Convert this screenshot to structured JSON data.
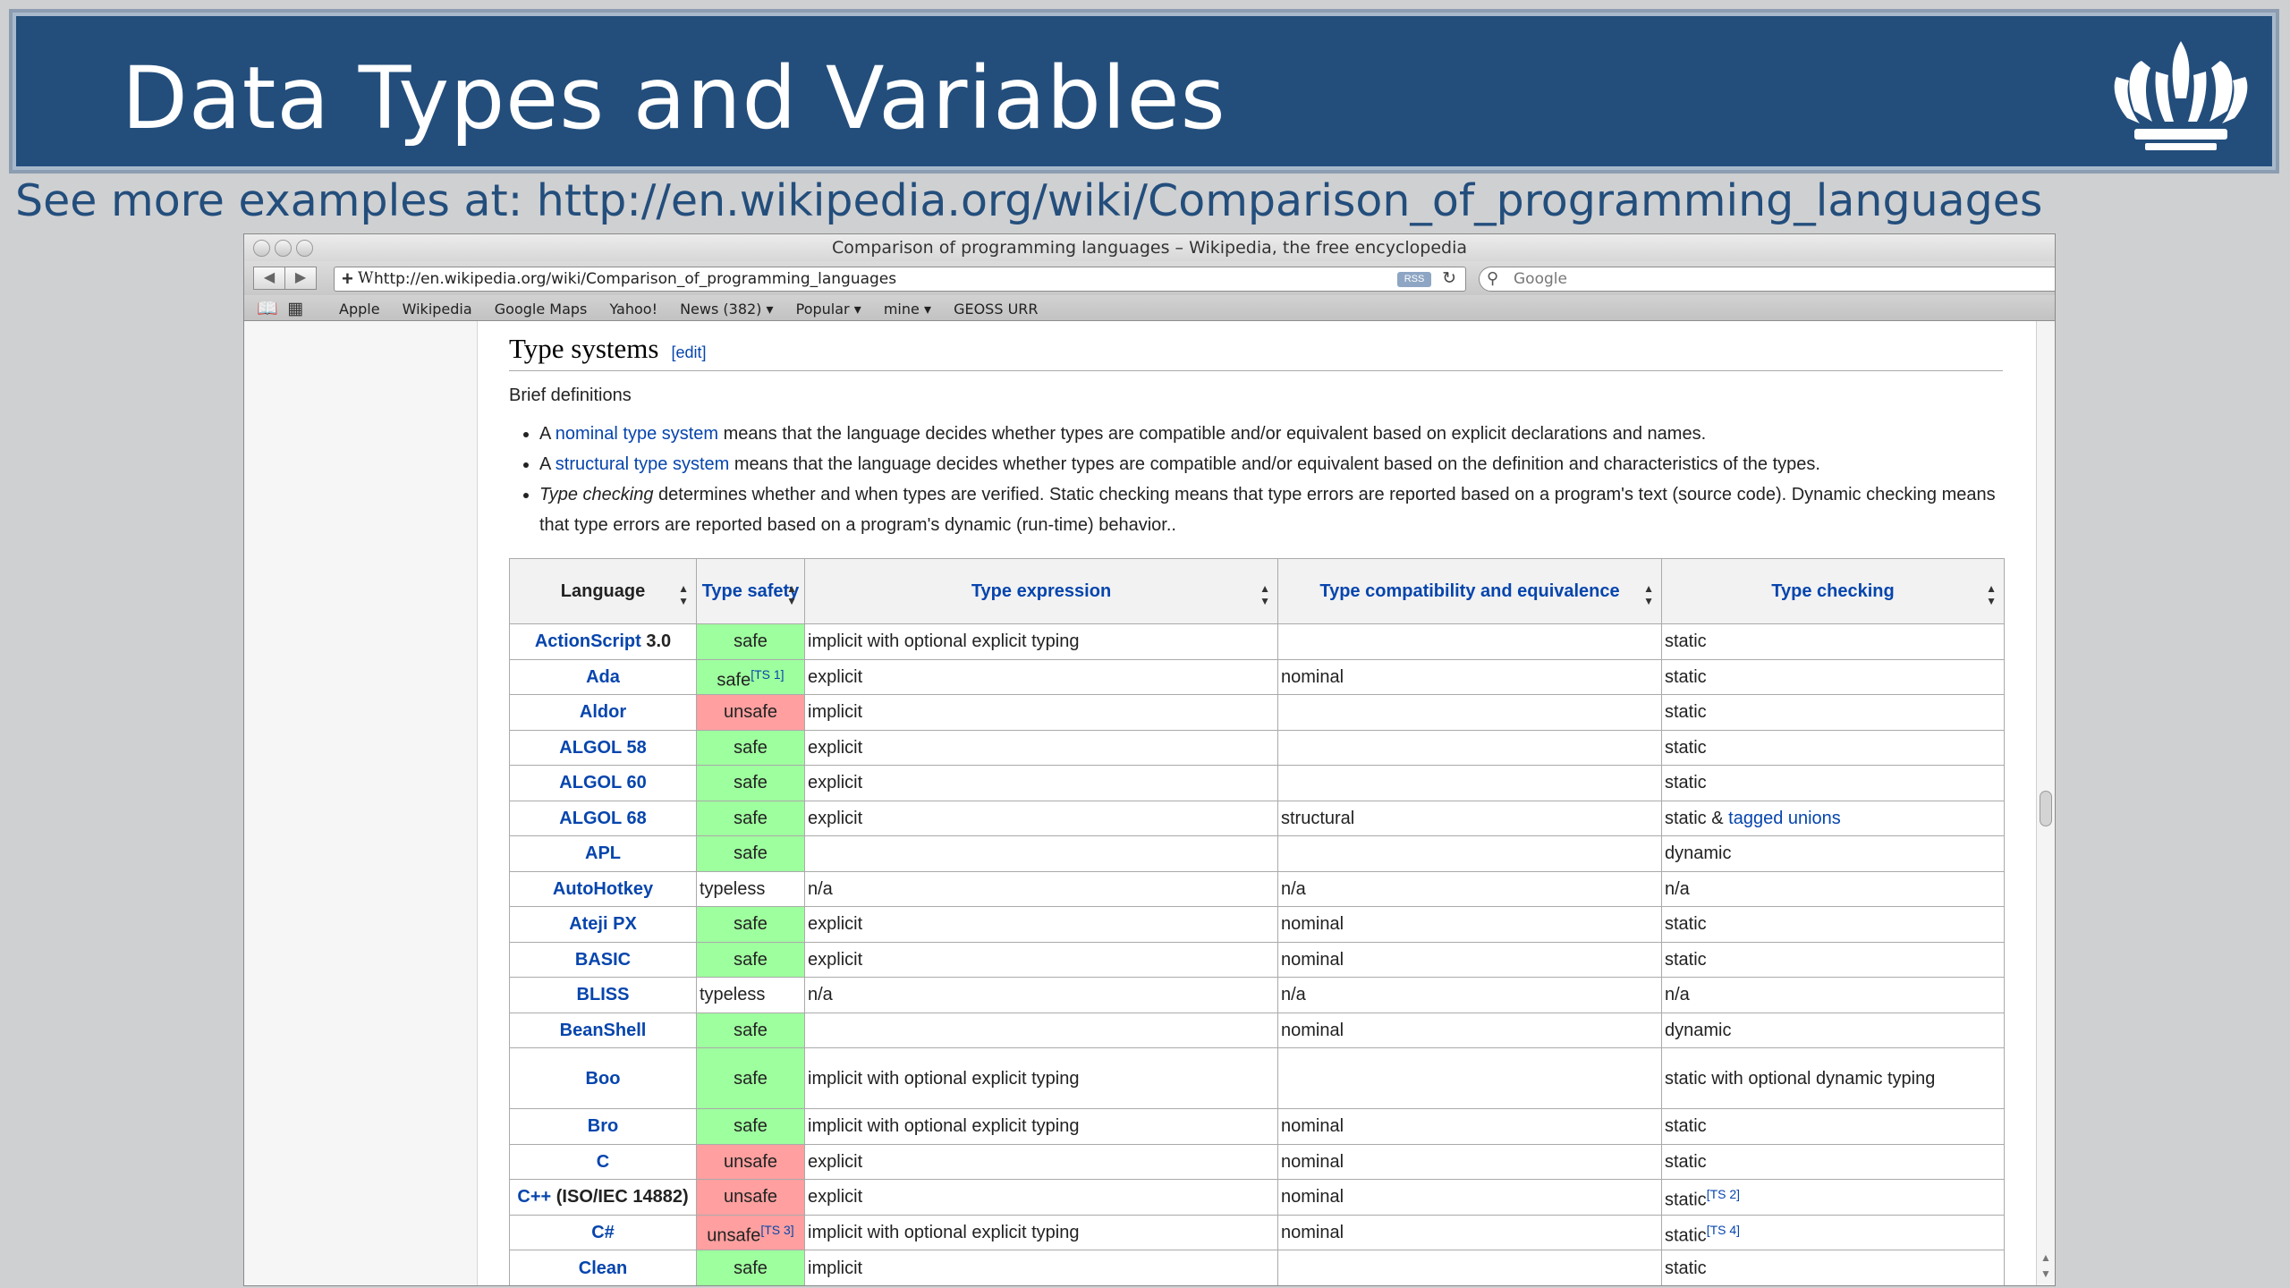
{
  "slide": {
    "title": "Data Types and Variables",
    "subtitle": "See more examples at: http://en.wikipedia.org/wiki/Comparison_of_programming_languages",
    "logo_icon": "crown-icon"
  },
  "browser": {
    "window_title": "Comparison of programming languages – Wikipedia, the free encyclopedia",
    "url": "http://en.wikipedia.org/wiki/Comparison_of_programming_languages",
    "rss_label": "RSS",
    "search_placeholder": "Google",
    "bookmarks": [
      "Apple",
      "Wikipedia",
      "Google Maps",
      "Yahoo!",
      "News (382) ▾",
      "Popular ▾",
      "mine ▾",
      "GEOSS URR"
    ]
  },
  "article": {
    "heading": "Type systems",
    "edit_label": "[edit]",
    "brief": "Brief definitions",
    "bullets": [
      {
        "prefix": "A ",
        "link": "nominal type system",
        "text": " means that the language decides whether types are compatible and/or equivalent based on explicit declarations and names."
      },
      {
        "prefix": "A ",
        "link": "structural type system",
        "text": " means that the language decides whether types are compatible and/or equivalent based on the definition and characteristics of the types."
      },
      {
        "italic": "Type checking",
        "text": " determines whether and when types are verified. Static checking means that type errors are reported based on a program's text (source code). Dynamic checking means that type errors are reported based on a program's dynamic (run-time) behavior.."
      }
    ]
  },
  "table": {
    "headers": [
      "Language",
      "Type safety",
      "Type expression",
      "Type compatibility and equivalence",
      "Type checking"
    ],
    "rows": [
      {
        "lang": "ActionScript",
        "lang_suffix": " 3.0",
        "safety": "safe",
        "safety_ref": "",
        "expr": "implicit with optional explicit typing",
        "compat": "",
        "checking": "static",
        "checking_ref": "",
        "checking_link": ""
      },
      {
        "lang": "Ada",
        "lang_suffix": "",
        "safety": "safe",
        "safety_ref": "[TS 1]",
        "expr": "explicit",
        "compat": "nominal",
        "checking": "static",
        "checking_ref": "",
        "checking_link": ""
      },
      {
        "lang": "Aldor",
        "lang_suffix": "",
        "safety": "unsafe",
        "safety_ref": "",
        "expr": "implicit",
        "compat": "",
        "checking": "static",
        "checking_ref": "",
        "checking_link": ""
      },
      {
        "lang": "ALGOL 58",
        "lang_suffix": "",
        "safety": "safe",
        "safety_ref": "",
        "expr": "explicit",
        "compat": "",
        "checking": "static",
        "checking_ref": "",
        "checking_link": ""
      },
      {
        "lang": "ALGOL 60",
        "lang_suffix": "",
        "safety": "safe",
        "safety_ref": "",
        "expr": "explicit",
        "compat": "",
        "checking": "static",
        "checking_ref": "",
        "checking_link": ""
      },
      {
        "lang": "ALGOL 68",
        "lang_suffix": "",
        "safety": "safe",
        "safety_ref": "",
        "expr": "explicit",
        "compat": "structural",
        "checking": "static & ",
        "checking_ref": "",
        "checking_link": "tagged unions"
      },
      {
        "lang": "APL",
        "lang_suffix": "",
        "safety": "safe",
        "safety_ref": "",
        "expr": "",
        "compat": "",
        "checking": "dynamic",
        "checking_ref": "",
        "checking_link": ""
      },
      {
        "lang": "AutoHotkey",
        "lang_suffix": "",
        "safety": "typeless",
        "safety_ref": "",
        "expr": "n/a",
        "compat": "n/a",
        "checking": "n/a",
        "checking_ref": "",
        "checking_link": ""
      },
      {
        "lang": "Ateji PX",
        "lang_suffix": "",
        "safety": "safe",
        "safety_ref": "",
        "expr": "explicit",
        "compat": "nominal",
        "checking": "static",
        "checking_ref": "",
        "checking_link": ""
      },
      {
        "lang": "BASIC",
        "lang_suffix": "",
        "safety": "safe",
        "safety_ref": "",
        "expr": "explicit",
        "compat": "nominal",
        "checking": "static",
        "checking_ref": "",
        "checking_link": ""
      },
      {
        "lang": "BLISS",
        "lang_suffix": "",
        "safety": "typeless",
        "safety_ref": "",
        "expr": "n/a",
        "compat": "n/a",
        "checking": "n/a",
        "checking_ref": "",
        "checking_link": ""
      },
      {
        "lang": "BeanShell",
        "lang_suffix": "",
        "safety": "safe",
        "safety_ref": "",
        "expr": "",
        "compat": "nominal",
        "checking": "dynamic",
        "checking_ref": "",
        "checking_link": ""
      },
      {
        "lang": "Boo",
        "lang_suffix": "",
        "safety": "safe",
        "safety_ref": "",
        "expr": "implicit with optional explicit typing",
        "compat": "",
        "checking": "static with optional dynamic typing",
        "checking_ref": "",
        "checking_link": "",
        "tall": true
      },
      {
        "lang": "Bro",
        "lang_suffix": "",
        "safety": "safe",
        "safety_ref": "",
        "expr": "implicit with optional explicit typing",
        "compat": "nominal",
        "checking": "static",
        "checking_ref": "",
        "checking_link": ""
      },
      {
        "lang": "C",
        "lang_suffix": "",
        "safety": "unsafe",
        "safety_ref": "",
        "expr": "explicit",
        "compat": "nominal",
        "checking": "static",
        "checking_ref": "",
        "checking_link": ""
      },
      {
        "lang": "C++",
        "lang_suffix": " (ISO/IEC 14882)",
        "safety": "unsafe",
        "safety_ref": "",
        "expr": "explicit",
        "compat": "nominal",
        "checking": "static",
        "checking_ref": "[TS 2]",
        "checking_link": ""
      },
      {
        "lang": "C#",
        "lang_suffix": "",
        "safety": "unsafe",
        "safety_ref": "[TS 3]",
        "expr": "implicit with optional explicit typing",
        "compat": "nominal",
        "checking": "static",
        "checking_ref": "[TS 4]",
        "checking_link": ""
      },
      {
        "lang": "Clean",
        "lang_suffix": "",
        "safety": "safe",
        "safety_ref": "",
        "expr": "implicit",
        "compat": "",
        "checking": "static",
        "checking_ref": "",
        "checking_link": ""
      }
    ]
  }
}
